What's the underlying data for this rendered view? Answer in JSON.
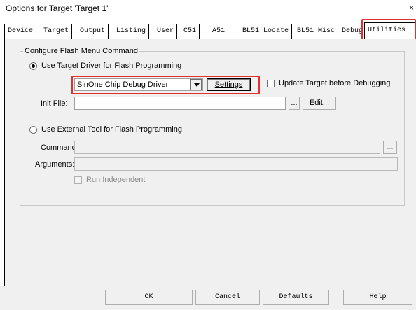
{
  "window": {
    "title": "Options for Target 'Target 1'",
    "close_glyph": "×"
  },
  "tabs": [
    {
      "label": "Device"
    },
    {
      "label": "Target"
    },
    {
      "label": "Output"
    },
    {
      "label": "Listing"
    },
    {
      "label": "User"
    },
    {
      "label": "C51"
    },
    {
      "label": "A51"
    },
    {
      "label": "BL51 Locate"
    },
    {
      "label": "BL51 Misc"
    },
    {
      "label": "Debug"
    },
    {
      "label": "Utilities",
      "active": true
    }
  ],
  "flash_group": {
    "legend": "Configure Flash Menu Command",
    "use_target_driver": {
      "label": "Use Target Driver for Flash Programming",
      "selected": true
    },
    "driver_select": {
      "value": "SinOne Chip Debug Driver"
    },
    "settings_button": "Settings",
    "update_target": {
      "label": "Update Target before Debugging",
      "checked": false
    },
    "init_file": {
      "label": "Init File:",
      "value": "",
      "browse_label": "...",
      "edit_label": "Edit..."
    },
    "use_external_tool": {
      "label": "Use External Tool for Flash Programming",
      "selected": false
    },
    "command": {
      "label": "Command:",
      "value": "",
      "browse_label": "..."
    },
    "arguments": {
      "label": "Arguments:",
      "value": ""
    },
    "run_independent": {
      "label": "Run Independent",
      "checked": false
    }
  },
  "footer": {
    "ok": "OK",
    "cancel": "Cancel",
    "defaults": "Defaults",
    "help": "Help"
  },
  "colors": {
    "highlight": "#e03030",
    "dialog_bg": "#f0f0f0"
  }
}
